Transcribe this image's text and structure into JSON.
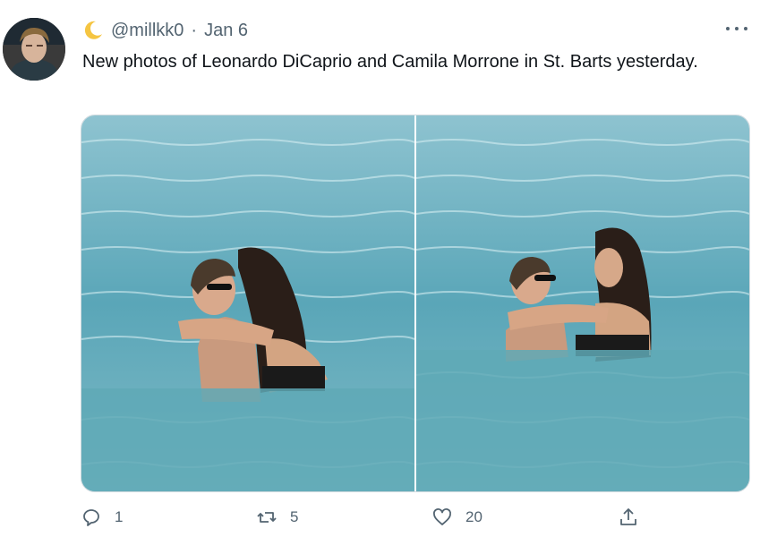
{
  "tweet": {
    "user": {
      "handle": "@millkk0",
      "badge_icon": "crescent-moon-icon"
    },
    "separator": "·",
    "date": "Jan 6",
    "text": "New photos of Leonardo DiCaprio and Camila Morrone in St. Barts yesterday.",
    "actions": {
      "reply_count": "1",
      "retweet_count": "5",
      "like_count": "20"
    },
    "colors": {
      "text_primary": "#0f1419",
      "text_secondary": "#536471",
      "sea": "#4e9fb0",
      "border": "#cfd9de"
    }
  }
}
